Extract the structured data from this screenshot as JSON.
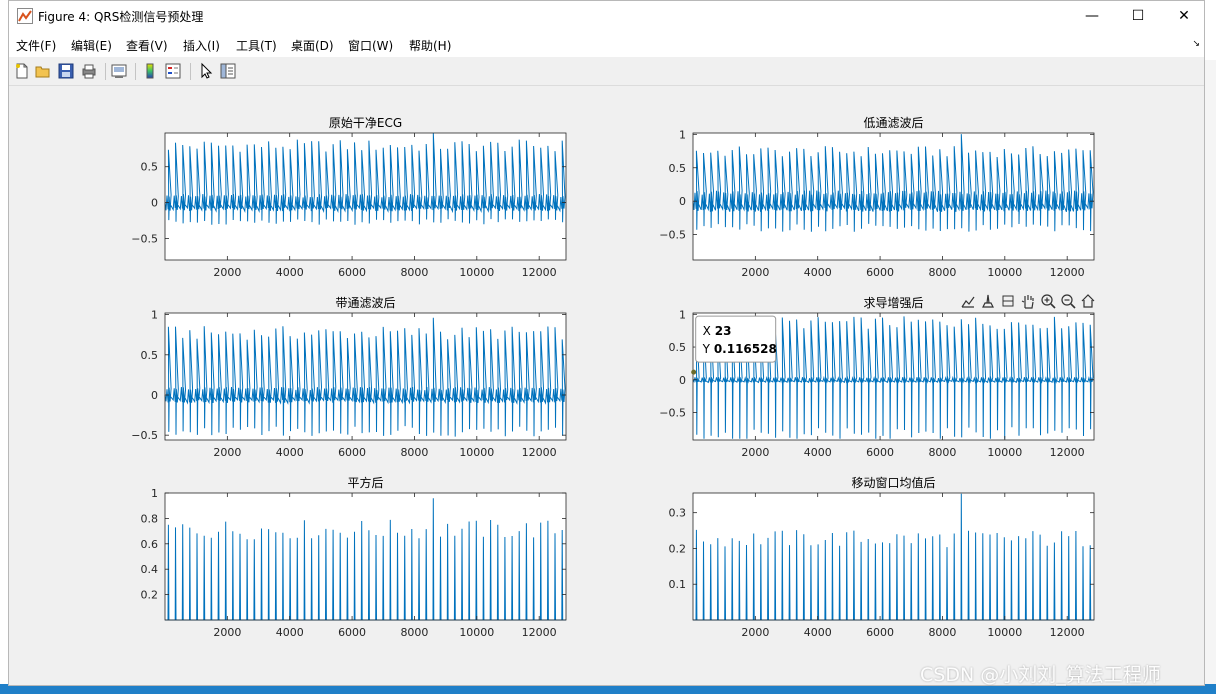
{
  "window": {
    "title": "Figure 4: QRS检测信号预处理",
    "minimize": "—",
    "maximize": "☐",
    "close": "✕"
  },
  "menu": [
    {
      "label": "文件(F)"
    },
    {
      "label": "编辑(E)"
    },
    {
      "label": "查看(V)"
    },
    {
      "label": "插入(I)"
    },
    {
      "label": "工具(T)"
    },
    {
      "label": "桌面(D)"
    },
    {
      "label": "窗口(W)"
    },
    {
      "label": "帮助(H)"
    }
  ],
  "toolbar_icons": [
    "new-figure-icon",
    "open-file-icon",
    "save-icon",
    "print-icon",
    "link-plot-icon",
    "colorbar-icon",
    "legend-icon",
    "edit-plot-icon",
    "property-inspector-icon"
  ],
  "axes_toolbar_icons": [
    "brush-icon",
    "data-cursor-icon",
    "rotate-icon",
    "pan-icon",
    "zoom-in-icon",
    "zoom-out-icon",
    "home-icon"
  ],
  "datatip": {
    "x_label": "X",
    "x_value": "23",
    "y_label": "Y",
    "y_value": "0.116528"
  },
  "watermark": "CSDN @小刘刘_算法工程师",
  "colors": {
    "line": "#0072bd",
    "figure_bg": "#f0f0f0",
    "axes_bg": "#ffffff"
  },
  "chart_data": [
    {
      "type": "line",
      "title": "原始干净ECG",
      "xlim": [
        1,
        12860
      ],
      "ylim": [
        -0.8,
        0.97
      ],
      "xticks": [
        2000,
        4000,
        6000,
        8000,
        10000,
        12000
      ],
      "yticks": [
        -0.5,
        0,
        0.5
      ],
      "ytick_labels": [
        "−0.5",
        "0",
        "0.5"
      ],
      "baseline": 0.0,
      "peak": 0.8,
      "trough": -0.27,
      "noise": 0.12,
      "beat_count": 56
    },
    {
      "type": "line",
      "title": "低通滤波后",
      "xlim": [
        1,
        12860
      ],
      "ylim": [
        -0.88,
        1.02
      ],
      "xticks": [
        2000,
        4000,
        6000,
        8000,
        10000,
        12000
      ],
      "yticks": [
        -0.5,
        0,
        0.5,
        1
      ],
      "ytick_labels": [
        "−0.5",
        "0",
        "0.5",
        "1"
      ],
      "baseline": 0.0,
      "peak": 0.75,
      "trough": -0.4,
      "noise": 0.16,
      "beat_count": 56
    },
    {
      "type": "line",
      "title": "带通滤波后",
      "xlim": [
        1,
        12860
      ],
      "ylim": [
        -0.56,
        1.02
      ],
      "xticks": [
        2000,
        4000,
        6000,
        8000,
        10000,
        12000
      ],
      "yticks": [
        -0.5,
        0,
        0.5,
        1
      ],
      "ytick_labels": [
        "−0.5",
        "0",
        "0.5",
        "1"
      ],
      "baseline": 0.0,
      "peak": 0.78,
      "trough": -0.45,
      "noise": 0.1,
      "beat_count": 56
    },
    {
      "type": "line",
      "title": "求导增强后",
      "xlim": [
        1,
        12860
      ],
      "ylim": [
        -0.92,
        1.02
      ],
      "xticks": [
        2000,
        4000,
        6000,
        8000,
        10000,
        12000
      ],
      "yticks": [
        -0.5,
        0,
        0.5,
        1
      ],
      "ytick_labels": [
        "−0.5",
        "0",
        "0.5",
        "1"
      ],
      "baseline": 0.0,
      "peak": 0.88,
      "trough": -0.85,
      "noise": 0.04,
      "beat_count": 56
    },
    {
      "type": "line",
      "title": "平方后",
      "xlim": [
        1,
        12860
      ],
      "ylim": [
        0,
        1
      ],
      "xticks": [
        2000,
        4000,
        6000,
        8000,
        10000,
        12000
      ],
      "yticks": [
        0.2,
        0.4,
        0.6,
        0.8,
        1
      ],
      "ytick_labels": [
        "0.2",
        "0.4",
        "0.6",
        "0.8",
        "1"
      ],
      "baseline": 0.0,
      "peak": 0.72,
      "trough": 0,
      "noise": 0.0,
      "beat_count": 56
    },
    {
      "type": "line",
      "title": "移动窗口均值后",
      "xlim": [
        1,
        12860
      ],
      "ylim": [
        0,
        0.355
      ],
      "xticks": [
        2000,
        4000,
        6000,
        8000,
        10000,
        12000
      ],
      "yticks": [
        0.1,
        0.2,
        0.3
      ],
      "ytick_labels": [
        "0.1",
        "0.2",
        "0.3"
      ],
      "baseline": 0.0,
      "peak": 0.23,
      "trough": 0,
      "noise": 0.0,
      "beat_count": 56
    }
  ]
}
